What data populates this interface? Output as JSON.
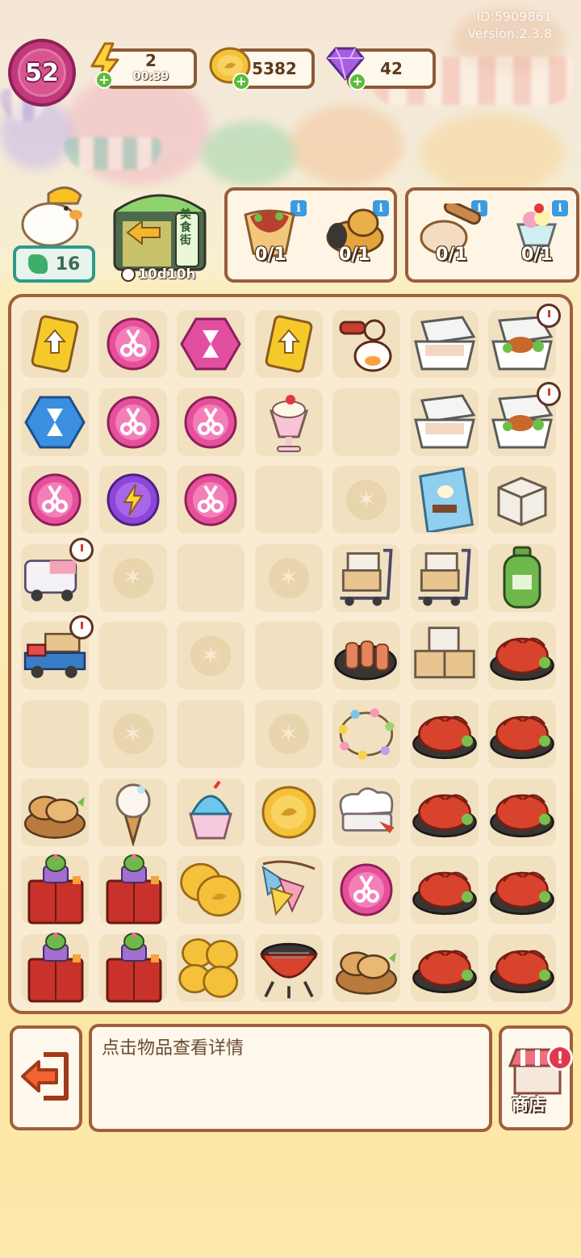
{
  "header": {
    "player_id": "ID:5909861",
    "version": "Version:2.3.8",
    "level": "52",
    "energy": {
      "value": "2",
      "timer": "00:39",
      "icon": "lightning-icon"
    },
    "coins": {
      "value": "5382",
      "icon": "coin-icon"
    },
    "gems": {
      "value": "42",
      "icon": "gem-icon"
    }
  },
  "characters": {
    "duck_level": "16",
    "food_street": {
      "sign": "美食街",
      "timer": "10d10h"
    }
  },
  "orders": [
    {
      "items": [
        {
          "name": "taco-wrap",
          "progress": "0/1"
        },
        {
          "name": "fried-chicken",
          "progress": "0/1"
        }
      ]
    },
    {
      "items": [
        {
          "name": "bread-dough",
          "progress": "0/1"
        },
        {
          "name": "fruit-sundae",
          "progress": "0/1"
        }
      ]
    }
  ],
  "board": {
    "columns": 7,
    "rows": 9,
    "cells": [
      [
        "ticket",
        "scissors-orb",
        "hourglass-gem-pink",
        "ticket",
        "keychain",
        "lunchbox-open",
        "lunchbox-meal-timer"
      ],
      [
        "hourglass-gem-blue",
        "scissors-orb",
        "scissors-orb",
        "milkshake",
        "empty",
        "lunchbox-open",
        "lunchbox-meal-timer"
      ],
      [
        "scissors-orb",
        "energy-orb",
        "scissors-orb",
        "empty",
        "locked",
        "snack-bag",
        "box-small"
      ],
      [
        "food-truck-timer",
        "locked",
        "empty",
        "locked",
        "hand-truck",
        "hand-truck",
        "gas-canister"
      ],
      [
        "pickup-truck-timer",
        "empty",
        "locked",
        "empty",
        "skewer-tray",
        "box-stack",
        "crayfish"
      ],
      [
        "empty",
        "locked",
        "empty",
        "locked",
        "string-lights",
        "crayfish",
        "crayfish"
      ],
      [
        "bread-basket",
        "ice-cream-cone",
        "shaved-ice",
        "coin",
        "chef-hat",
        "crayfish",
        "crayfish"
      ],
      [
        "cabinet-cactus",
        "cabinet-cactus",
        "coin-pile",
        "bunting-flags",
        "scissors-orb",
        "crayfish",
        "crayfish"
      ],
      [
        "cabinet-cactus",
        "cabinet-cactus",
        "coin-pile-large",
        "grill",
        "bread-basket",
        "crayfish",
        "crayfish"
      ]
    ]
  },
  "footer": {
    "exit_icon": "exit-icon",
    "detail_text": "点击物品查看详情",
    "shop_label": "商店",
    "shop_alert": "!"
  }
}
